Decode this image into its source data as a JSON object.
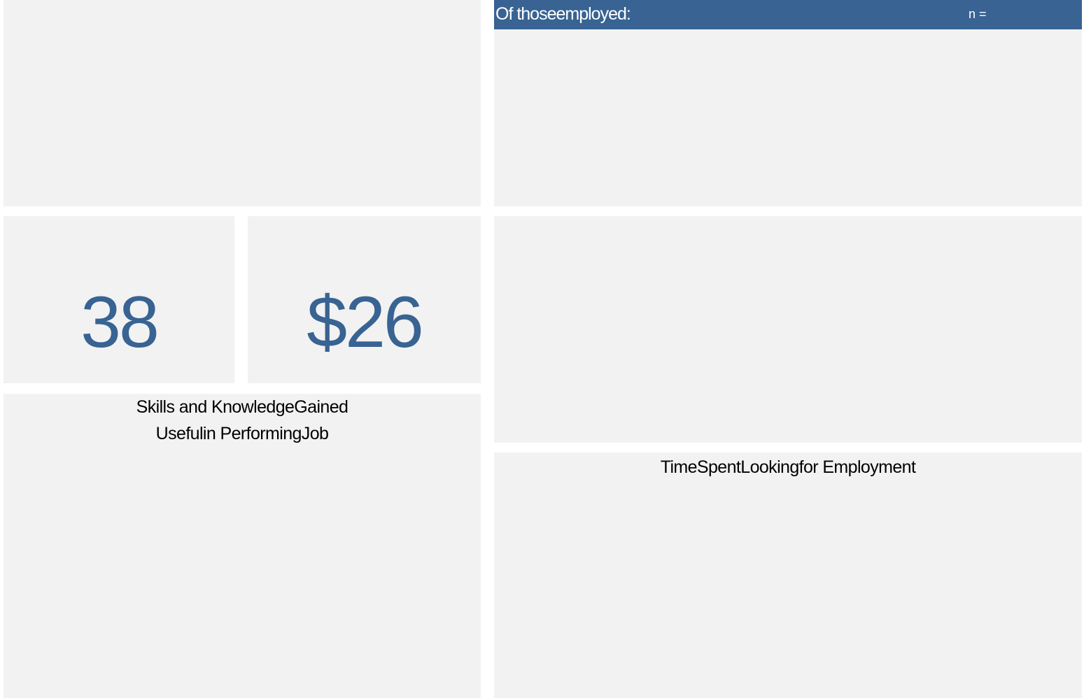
{
  "header": {
    "title": "Of thoseemployed:",
    "n_label": "n ="
  },
  "metrics": {
    "left_value": "38",
    "right_value": "$26"
  },
  "captions": {
    "skills_line1": "Skills and KnowledgeGained",
    "skills_line2": "Usefulin PerformingJob",
    "time_spent": "TimeSpentLookingfor Employment"
  },
  "colors": {
    "accent": "#386393",
    "panel_background": "#f2f2f2",
    "page_background": "#ffffff"
  }
}
